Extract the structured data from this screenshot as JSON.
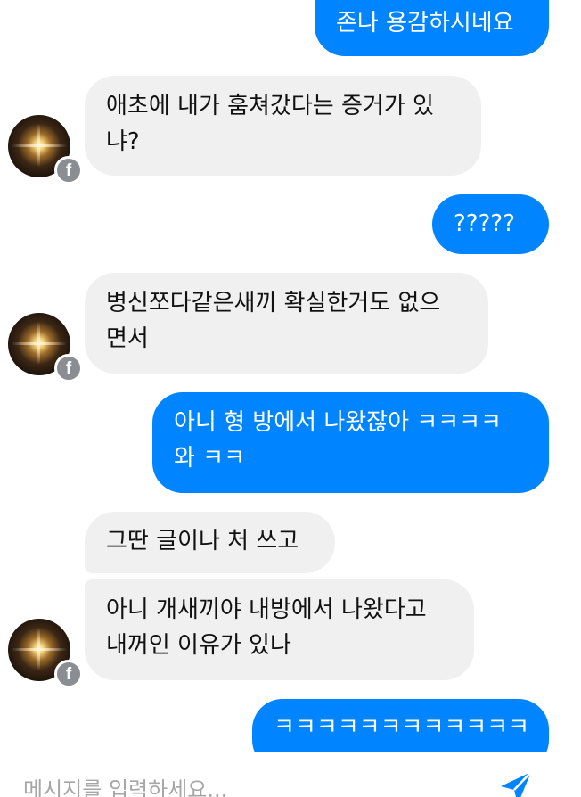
{
  "messages": [
    {
      "direction": "outgoing",
      "lines": [
        "존나 용감하시네요"
      ]
    },
    {
      "direction": "incoming",
      "lines": [
        "애초에 내가 훔쳐갔다는 증거가 있",
        "냐?"
      ]
    },
    {
      "direction": "outgoing",
      "lines": [
        "?????"
      ]
    },
    {
      "direction": "incoming",
      "lines": [
        "병신쪼다같은새끼 확실한거도 없으",
        "면서"
      ]
    },
    {
      "direction": "outgoing",
      "lines": [
        "아니 형 방에서 나왔잖아 ㅋㅋㅋㅋ",
        "와 ㅋㅋ"
      ]
    },
    {
      "direction": "incoming",
      "lines": [
        "그딴 글이나 처 쓰고"
      ]
    },
    {
      "direction": "incoming",
      "lines": [
        "아니 개새끼야 내방에서 나왔다고",
        "내꺼인 이유가 있나"
      ]
    },
    {
      "direction": "outgoing",
      "lines": [
        "ㅋㅋㅋㅋㅋㅋㅋㅋㅋㅋㅋㅋ"
      ]
    }
  ],
  "avatar": {
    "badge_glyph": "f",
    "badge_icon": "facebook-icon"
  },
  "composer": {
    "placeholder": "메시지를 입력하세요...",
    "value": "",
    "send_icon": "send-arrow-icon"
  },
  "colors": {
    "outgoing_bubble": "#0084ff",
    "incoming_bubble": "#f1f0f0",
    "send_icon": "#0084ff",
    "badge": "#8a8d91"
  }
}
